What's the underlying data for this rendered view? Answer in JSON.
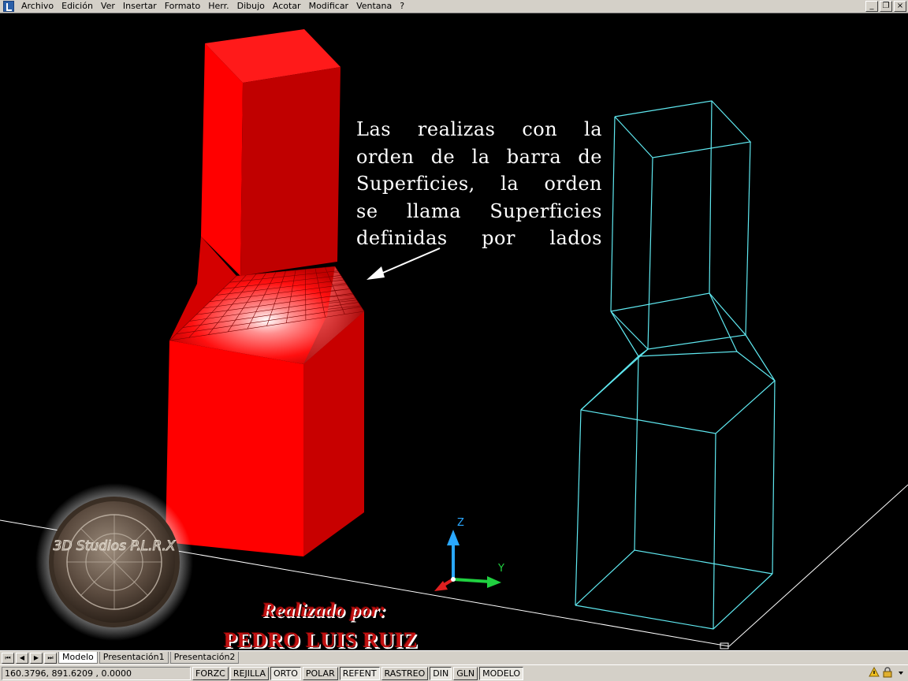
{
  "menubar": {
    "items": [
      "Archivo",
      "Edición",
      "Ver",
      "Insertar",
      "Formato",
      "Herr.",
      "Dibujo",
      "Acotar",
      "Modificar",
      "Ventana",
      "?"
    ],
    "window_controls": [
      "_",
      "❐",
      "×"
    ]
  },
  "annotation": {
    "lines": [
      "Las realizas con la",
      "orden de la barra de",
      "Superficies, la orden",
      "se llama Superficies",
      "definidas por lados"
    ]
  },
  "ucs_icon": {
    "z": "Z",
    "y": "Y"
  },
  "watermark": {
    "logo_text": "3D Studios P.L.R.X"
  },
  "credit": {
    "line1": "Realizado por:",
    "line2": "PEDRO LUIS RUIZ"
  },
  "tabs": {
    "nav": [
      "⏮",
      "◀",
      "▶",
      "⏭"
    ],
    "layouts": [
      "Modelo",
      "Presentación1",
      "Presentación2"
    ]
  },
  "statusbar": {
    "coords": "160.3796, 891.6209 , 0.0000",
    "modes": [
      "FORZC",
      "REJILLA",
      "ORTO",
      "POLAR",
      "REFENT",
      "RASTREO",
      "DIN",
      "GLN",
      "MODELO"
    ],
    "active_modes": [
      "ORTO",
      "REFENT",
      "DIN",
      "MODELO"
    ]
  },
  "colors": {
    "solid_red": "#ff0000",
    "wire_cyan": "#5fe8f0",
    "ucs_z": "#2aa8ff",
    "ucs_y": "#20d040",
    "ucs_x": "#e02020"
  }
}
